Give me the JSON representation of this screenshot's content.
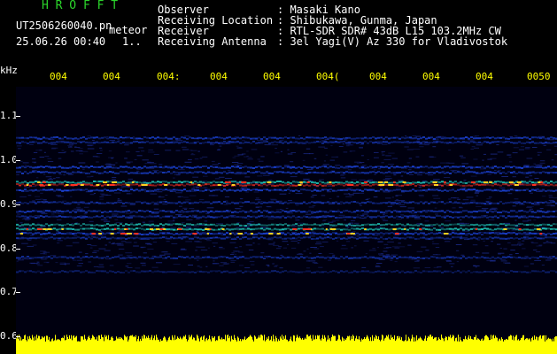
{
  "app": {
    "name": "H R O F F T",
    "filename": "UT2506260040.pn",
    "type": "meteor",
    "datetime": "25.06.26 00:40",
    "extra": "1..",
    "name_color": "#2bd62b"
  },
  "info": {
    "labels": [
      "Observer",
      "Receiving Location",
      "Receiver",
      "Receiving Antenna"
    ],
    "values": [
      ": Masaki Kano",
      ": Shibukawa, Gunma, Japan",
      ": RTL-SDR SDR# 43dB L15 103.2MHz CW",
      ": 3el Yagi(V) Az 330 for Vladivostok"
    ]
  },
  "plot": {
    "y_unit": "kHz",
    "y_ticks": [
      "1.1",
      "1.0",
      "0.9",
      "0.8",
      "0.7",
      "0.6"
    ],
    "x_ticks": [
      "004",
      "004",
      "004:",
      "004",
      "004",
      "004(",
      "004",
      "004",
      "004",
      "0050"
    ],
    "x_tick_color": "#ffff00",
    "background": "#000010",
    "noise_color": "#1a2a8a",
    "signal_color_low": "#2050ff",
    "signal_color_mid": "#20d0c0",
    "signal_color_high": "#ff3020",
    "bar_color": "#ffff00"
  }
}
